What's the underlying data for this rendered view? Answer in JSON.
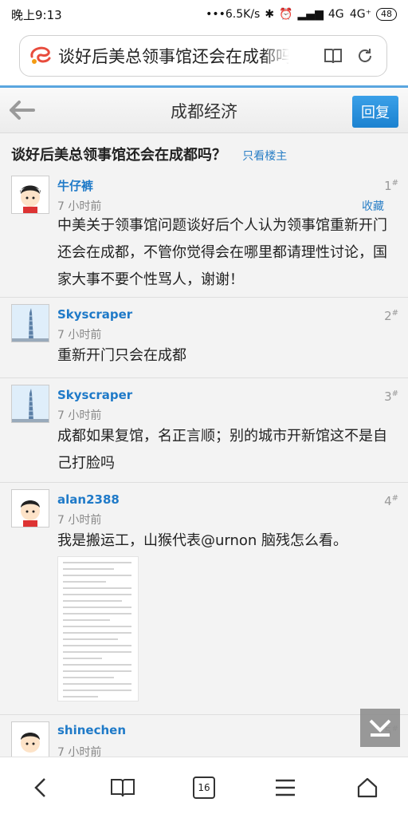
{
  "status_bar": {
    "time": "晚上9:13",
    "speed": "•••6.5K/s",
    "network": "4G  4G⁺",
    "battery": "48"
  },
  "browser": {
    "url_text": "谈好后美总领事馆还会在成都吗",
    "tab_count": "16"
  },
  "header": {
    "title": "成都经济",
    "reply_label": "回复"
  },
  "thread": {
    "title": "谈好后美总领事馆还会在成都吗？",
    "only_op_label": "只看楼主"
  },
  "posts": [
    {
      "user": "牛仔裤",
      "time": "7 小时前",
      "floor": "1",
      "fav_label": "收藏",
      "content": "中美关于领事馆问题谈好后个人认为领事馆重新开门还会在成都，不管你觉得会在哪里都请理性讨论，国家大事不要个性骂人，谢谢！"
    },
    {
      "user": "Skyscraper",
      "time": "7 小时前",
      "floor": "2",
      "content": "重新开门只会在成都"
    },
    {
      "user": "Skyscraper",
      "time": "7 小时前",
      "floor": "3",
      "content": "成都如果复馆，名正言顺；别的城市开新馆这不是自己打脸吗"
    },
    {
      "user": "alan2388",
      "time": "7 小时前",
      "floor": "4",
      "content": "我是搬运工，山猴代表@urnon 脑残怎么看。"
    },
    {
      "user": "shinechen",
      "time": "7 小时前",
      "floor": "5"
    }
  ],
  "floor_mark": "#",
  "colors": {
    "accent": "#1f7ac8",
    "reply_button": "#1c82d0",
    "top_line": "#5aa6df"
  },
  "icons": {
    "url_logo": "sogou-logo-icon",
    "reader": "book-icon",
    "refresh": "refresh-icon",
    "back": "back-arrow-icon",
    "fab": "scroll-to-bottom-icon"
  }
}
